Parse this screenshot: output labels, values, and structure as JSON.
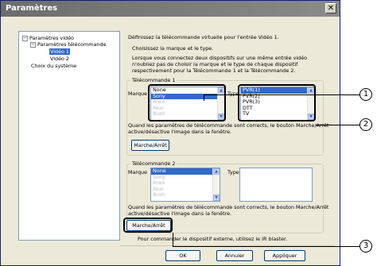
{
  "window": {
    "title": "Paramètres",
    "close_glyph": "✕"
  },
  "tree": {
    "items": [
      {
        "label": "Paramètres vidéo",
        "expander": "−"
      },
      {
        "label": "Paramètres télécommande",
        "expander": "−"
      },
      {
        "label": "Vidéo 1"
      },
      {
        "label": "Vidéo 2"
      },
      {
        "label": "Choix du système"
      }
    ]
  },
  "intro": {
    "line1": "Définissez la télécommande virtuelle pour l'entrée Vidéo 1.",
    "line2": "Choisissez la marque et le type.",
    "line3": "Lorsque vous connectez deux dispositifs sur une même entrée vidéo",
    "line4": "n'oubliez pas de choisir la marque et le type de chaque dispositif",
    "line5": "respectivement pour la Télécommande 1 et la Télécommande 2."
  },
  "remote1": {
    "group_label": "Télécommande 1",
    "brand_label": "Marque",
    "type_label": "Type",
    "brands": [
      "None",
      "Sony",
      "Aiwa",
      "Akai",
      "Bush"
    ],
    "types": [
      "PVR(1)",
      "PVR(2)",
      "PVR(3)",
      "DTT",
      "TV"
    ],
    "note1": "Quand les paramètres de télécommande sont corrects, le bouton Marche/Arrêt",
    "note2": "active/désactive l'image dans la fenêtre.",
    "power_button": "Marche/Arrêt"
  },
  "remote2": {
    "group_label": "Télécommande 2",
    "brand_label": "Marque",
    "type_label": "Type",
    "brands": [
      "None",
      "Sony",
      "Aiwa",
      "Akai",
      "Bush"
    ],
    "note1": "Quand les paramètres de télécommande sont corrects, le bouton Marche/Arrêt",
    "note2": "active/désactive l'image dans la fenêtre.",
    "power_button": "Marche/Arrêt"
  },
  "footer_note": "Pour commander le dispositif externe, utilisez le IR blaster.",
  "buttons": {
    "ok": "OK",
    "cancel": "Annuler",
    "apply": "Appliquer"
  },
  "callouts": [
    "1",
    "2",
    "3"
  ],
  "colors": {
    "selection": "#316ac5",
    "dialog_bg": "#ece9d8",
    "titlebar": "#7a7a7a"
  }
}
